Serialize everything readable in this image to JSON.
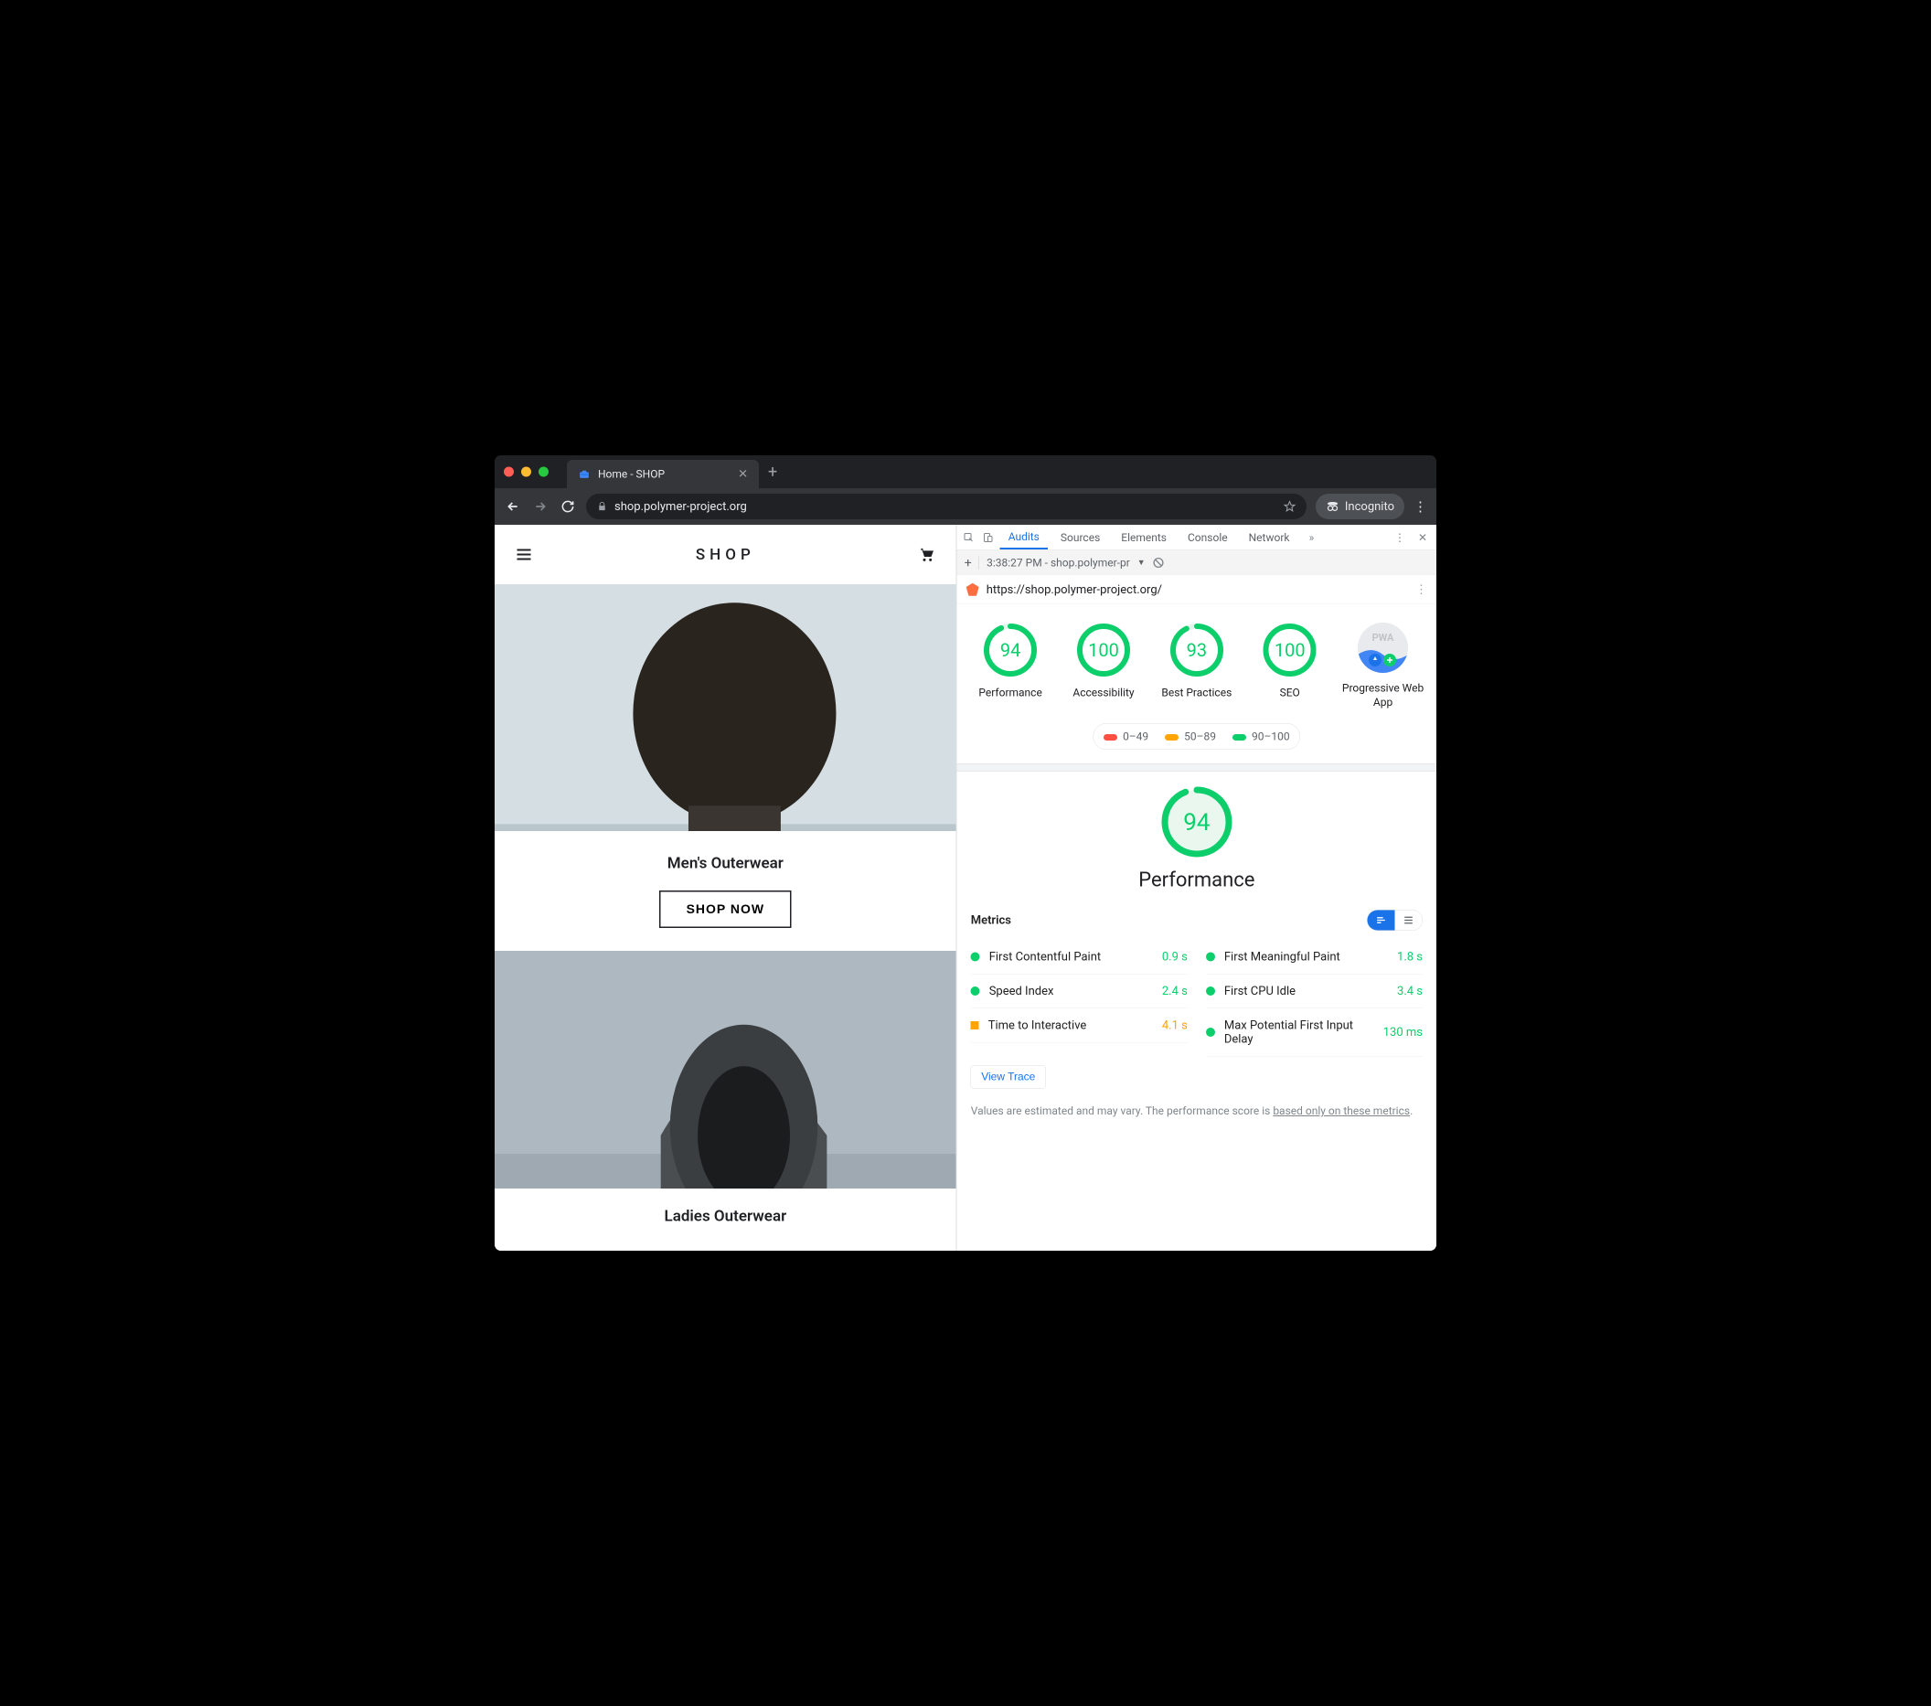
{
  "browser": {
    "tab_title": "Home - SHOP",
    "url_display": "shop.polymer-project.org",
    "incognito_label": "Incognito"
  },
  "page": {
    "brand": "SHOP",
    "sections": [
      {
        "title": "Men's Outerwear",
        "cta": "SHOP NOW"
      },
      {
        "title": "Ladies Outerwear"
      }
    ]
  },
  "devtools": {
    "panels": [
      "Audits",
      "Sources",
      "Elements",
      "Console",
      "Network"
    ],
    "active_panel": "Audits",
    "run_label": "3:38:27 PM - shop.polymer-pr",
    "audit_url": "https://shop.polymer-project.org/",
    "scores": [
      {
        "value": 94,
        "label": "Performance",
        "color": "#0cce6b"
      },
      {
        "value": 100,
        "label": "Accessibility",
        "color": "#0cce6b"
      },
      {
        "value": 93,
        "label": "Best Practices",
        "color": "#0cce6b"
      },
      {
        "value": 100,
        "label": "SEO",
        "color": "#0cce6b"
      }
    ],
    "pwa_label": "Progressive Web App",
    "legend": [
      {
        "range": "0–49",
        "color": "#ff4e42"
      },
      {
        "range": "50–89",
        "color": "#ffa400"
      },
      {
        "range": "90–100",
        "color": "#0cce6b"
      }
    ],
    "big_score": {
      "value": 94,
      "label": "Performance"
    },
    "metrics_title": "Metrics",
    "metrics_left": [
      {
        "label": "First Contentful Paint",
        "value": "0.9 s",
        "status": "green"
      },
      {
        "label": "Speed Index",
        "value": "2.4 s",
        "status": "green"
      },
      {
        "label": "Time to Interactive",
        "value": "4.1 s",
        "status": "orange"
      }
    ],
    "metrics_right": [
      {
        "label": "First Meaningful Paint",
        "value": "1.8 s",
        "status": "green"
      },
      {
        "label": "First CPU Idle",
        "value": "3.4 s",
        "status": "green"
      },
      {
        "label": "Max Potential First Input Delay",
        "value": "130 ms",
        "status": "green"
      }
    ],
    "view_trace": "View Trace",
    "footnote_prefix": "Values are estimated and may vary. The performance score is ",
    "footnote_link": "based only on these metrics",
    "footnote_suffix": "."
  }
}
